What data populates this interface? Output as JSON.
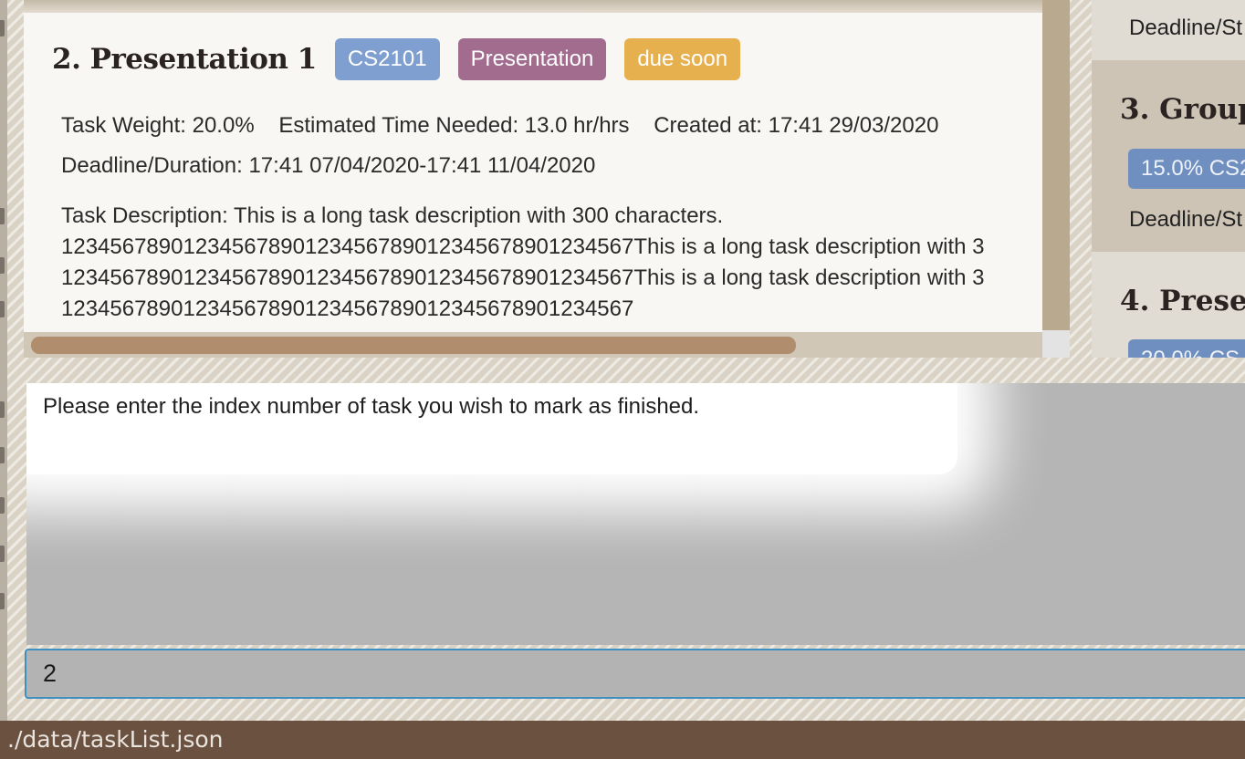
{
  "card": {
    "title": "2.  Presentation 1",
    "badges": {
      "module": "CS2101",
      "type": "Presentation",
      "status": "due soon"
    },
    "weight": "Task Weight: 20.0%",
    "time_needed": "Estimated Time Needed: 13.0 hr/hrs",
    "created": "Created at: 17:41 29/03/2020",
    "deadline": "Deadline/Duration: 17:41 07/04/2020-17:41 11/04/2020",
    "description_lines": [
      "Task Description: This is a long task description with 300 characters.",
      "12345678901234567890123456789012345678901234567This is a long task description with 3",
      "12345678901234567890123456789012345678901234567This is a long task description with 3",
      "12345678901234567890123456789012345678901234567"
    ]
  },
  "task_list": {
    "item_top_line": "Deadline/St",
    "item3": {
      "title": "3.  Group",
      "badge": "15.0% CS2",
      "line": "Deadline/St"
    },
    "item4": {
      "title": "4.  Preser",
      "badge": "20.0% CS"
    }
  },
  "result": {
    "text": "Please enter the index number of task you wish to mark as finished."
  },
  "command": {
    "value": "2"
  },
  "status_bar": {
    "file_path": "./data/taskList.json"
  },
  "colors": {
    "module_badge": "#7f9fd0",
    "type_badge": "#a16c8e",
    "due_badge": "#e6b04f",
    "status_bar": "#6b5140",
    "command_border": "#3f8fc0"
  }
}
